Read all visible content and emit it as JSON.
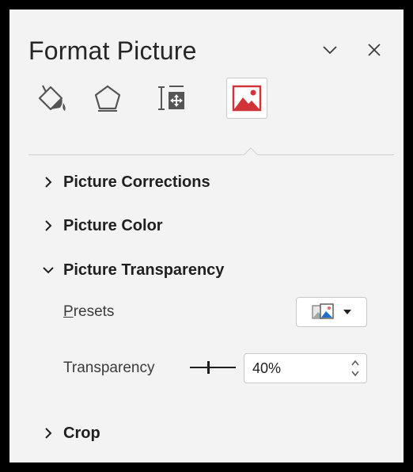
{
  "pane": {
    "title": "Format Picture",
    "options_icon": "chevron-down-icon",
    "close_icon": "close-icon"
  },
  "tabs": [
    {
      "name": "fill-line-icon",
      "active": false
    },
    {
      "name": "effects-icon",
      "active": false
    },
    {
      "name": "size-properties-icon",
      "active": false
    },
    {
      "name": "picture-icon",
      "active": true
    }
  ],
  "sections": {
    "corrections": {
      "label": "Picture Corrections",
      "expanded": false
    },
    "color": {
      "label": "Picture Color",
      "expanded": false
    },
    "transparency": {
      "label": "Picture Transparency",
      "expanded": true
    },
    "crop": {
      "label": "Crop",
      "expanded": false
    }
  },
  "transparency": {
    "presets_label_first": "P",
    "presets_label_rest": "resets",
    "transparency_label": "Transparency",
    "value": "40%",
    "level": 0.4
  },
  "colors": {
    "accent": "#d13438",
    "pane_bg": "#f3f3f3",
    "border": "#000000"
  }
}
